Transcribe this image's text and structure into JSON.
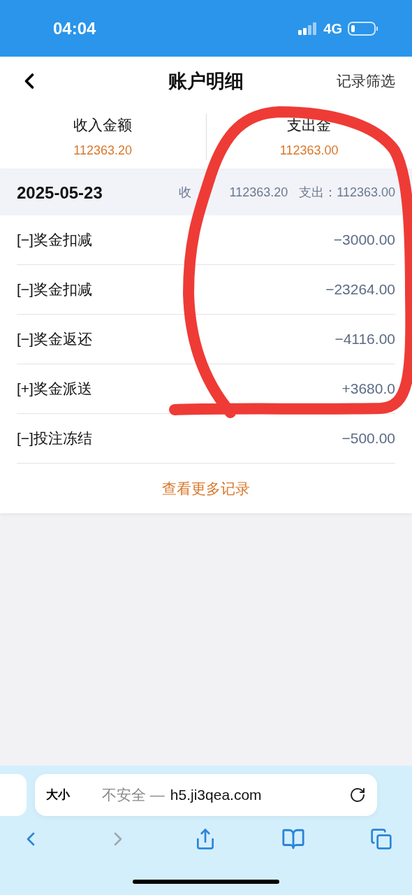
{
  "status_bar": {
    "time": "04:04",
    "network": "4G"
  },
  "nav": {
    "title": "账户明细",
    "action": "记录筛选"
  },
  "summary": [
    {
      "label": "收入金额",
      "amount": "112363.20"
    },
    {
      "label": "支出金",
      "amount": "112363.00"
    }
  ],
  "day": {
    "date": "2025-05-23",
    "income_label": "收",
    "income": "112363.20",
    "expense_label": "支出：",
    "expense": "112363.00"
  },
  "records": [
    {
      "name": "[−]奖金扣减",
      "amount": "−3000.00"
    },
    {
      "name": "[−]奖金扣减",
      "amount": "−23264.00"
    },
    {
      "name": "[−]奖金返还",
      "amount": "−4116.00"
    },
    {
      "name": "[+]奖金派送",
      "amount": "+3680.0"
    },
    {
      "name": "[−]投注冻结",
      "amount": "−500.00"
    }
  ],
  "more_link": "查看更多记录",
  "browser": {
    "text_size": "大小",
    "security": "不安全 —",
    "url": "h5.ji3qea.com"
  }
}
